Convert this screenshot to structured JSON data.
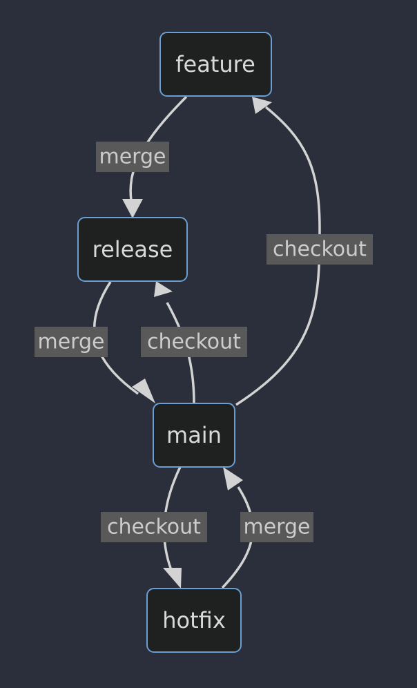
{
  "diagram": {
    "type": "flowchart",
    "colors": {
      "background": "#2a2f3b",
      "node_fill": "#1f2020",
      "node_stroke": "#6b9fd4",
      "node_text": "#d9d9d9",
      "edge": "#d3d3d3",
      "label_bg": "#595959",
      "label_text": "#cccccc"
    },
    "nodes": [
      {
        "id": "feature",
        "label": "feature"
      },
      {
        "id": "release",
        "label": "release"
      },
      {
        "id": "main",
        "label": "main"
      },
      {
        "id": "hotfix",
        "label": "hotfix"
      }
    ],
    "edges": [
      {
        "from": "feature",
        "to": "release",
        "label": "merge"
      },
      {
        "from": "release",
        "to": "main",
        "label": "merge"
      },
      {
        "from": "main",
        "to": "release",
        "label": "checkout"
      },
      {
        "from": "main",
        "to": "feature",
        "label": "checkout"
      },
      {
        "from": "main",
        "to": "hotfix",
        "label": "checkout"
      },
      {
        "from": "hotfix",
        "to": "main",
        "label": "merge"
      }
    ]
  }
}
